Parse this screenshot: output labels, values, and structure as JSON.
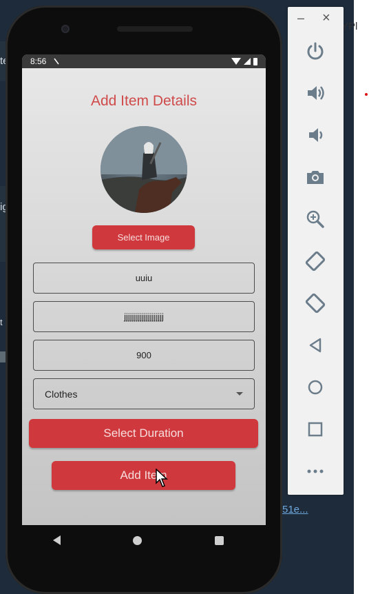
{
  "background": {
    "left_frag_1": "te",
    "left_frag_2": "ig",
    "left_frag_3": "t n",
    "right_frag_top": "YPl",
    "right_link": "51e..."
  },
  "phone": {
    "status": {
      "time": "8:56"
    },
    "screen": {
      "title": "Add Item Details",
      "select_image_label": "Select Image",
      "item_name_value": "uuiu",
      "item_description_value": "jjjjjjjjjjjjjjjjjjjj",
      "item_price_value": "900",
      "category": {
        "selected": "Clothes"
      },
      "select_duration_label": "Select Duration",
      "add_item_label": "Add Item"
    }
  },
  "emulator_panel": {
    "minimize_glyph": "–",
    "close_glyph": "×",
    "buttons": [
      "power-icon",
      "volume-up-icon",
      "volume-down-icon",
      "camera-icon",
      "zoom-icon",
      "rotate-left-icon",
      "rotate-right-icon",
      "back-icon",
      "home-icon",
      "overview-icon",
      "more-icon"
    ]
  },
  "colors": {
    "accent": "#cf393d",
    "title": "#d04a4a",
    "panel_icon": "#6b7c8a"
  }
}
